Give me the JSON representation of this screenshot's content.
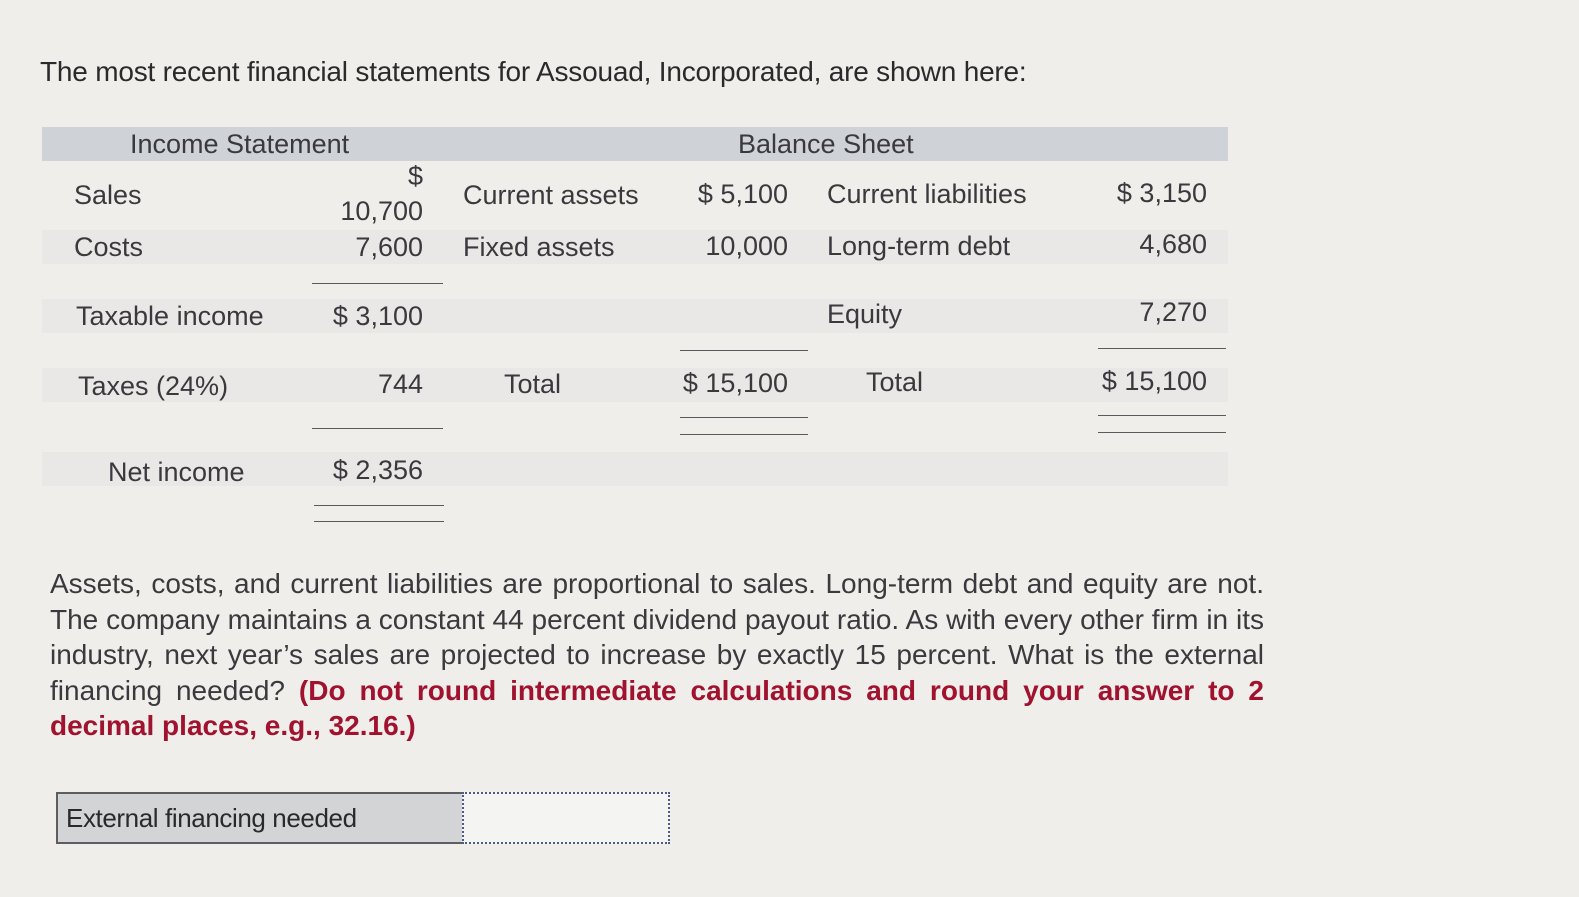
{
  "intro": "The most recent financial statements for Assouad, Incorporated, are shown here:",
  "income_statement": {
    "title": "Income Statement",
    "sales_label": "Sales",
    "sales_dollar": "$",
    "sales_value": "10,700",
    "costs_label": "Costs",
    "costs_value": "7,600",
    "taxable_label": "Taxable income",
    "taxable_value": "$ 3,100",
    "taxes_label": "Taxes (24%)",
    "taxes_value": "744",
    "net_label": "Net income",
    "net_value": "$ 2,356"
  },
  "balance_sheet": {
    "title": "Balance Sheet",
    "assets": {
      "current_label": "Current assets",
      "current_value": "$ 5,100",
      "fixed_label": "Fixed assets",
      "fixed_value": "10,000",
      "total_label": "Total",
      "total_value": "$ 15,100"
    },
    "liabilities": {
      "current_label": "Current liabilities",
      "current_value": "$ 3,150",
      "ltd_label": "Long-term debt",
      "ltd_value": "4,680",
      "equity_label": "Equity",
      "equity_value": "7,270",
      "total_label": "Total",
      "total_value": "$ 15,100"
    }
  },
  "question": {
    "text": "Assets, costs, and current liabilities are proportional to sales. Long-term debt and equity are not. The company maintains a constant 44 percent dividend payout ratio. As with every other firm in its industry, next year’s sales are projected to increase by exactly 15 percent. What is the external financing needed?",
    "instruction": "(Do not round intermediate calculations and round your answer to 2 decimal places, e.g., 32.16.)"
  },
  "answer": {
    "label": "External financing needed",
    "value": ""
  },
  "colors": {
    "instruction_red": "#a1122f",
    "header_gray": "#cfd2d6",
    "input_border": "#4f5a82"
  }
}
